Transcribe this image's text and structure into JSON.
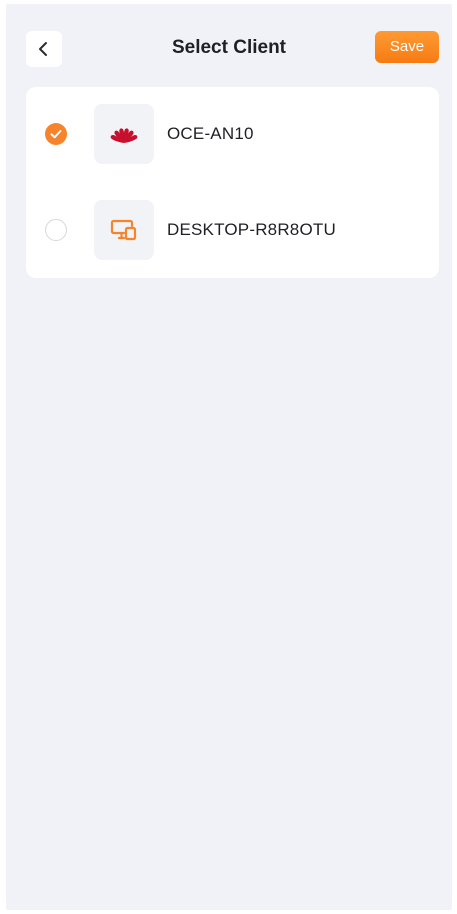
{
  "header": {
    "title": "Select Client",
    "back_icon": "chevron-left-icon",
    "save_label": "Save"
  },
  "clients": [
    {
      "name": "OCE-AN10",
      "icon": "huawei-logo-icon",
      "selected": true
    },
    {
      "name": "DESKTOP-R8R8OTU",
      "icon": "desktop-devices-icon",
      "selected": false
    }
  ],
  "colors": {
    "accent": "#f7832a",
    "background": "#f1f2f7",
    "card": "#ffffff",
    "huawei_red": "#c8102e",
    "text": "#1f1f24"
  }
}
